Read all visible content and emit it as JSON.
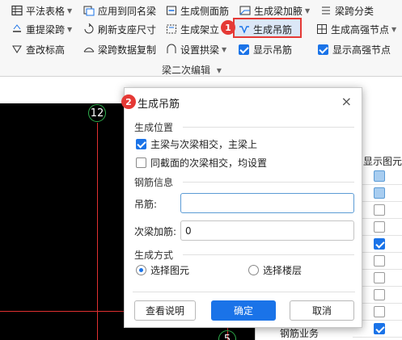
{
  "colors": {
    "accent": "#1a73e8",
    "annotation_red": "#e53935",
    "axis_red": "#e03030",
    "axis_green": "#2fae4c"
  },
  "ribbon": {
    "row1": [
      {
        "label": "平法表格",
        "icon": "table-icon",
        "dropdown": true
      },
      {
        "label": "应用到同名梁",
        "icon": "apply-same-name-icon",
        "dropdown": false
      },
      {
        "label": "生成侧面筋",
        "icon": "side-rebar-icon",
        "dropdown": false
      },
      {
        "label": "生成梁加腋",
        "icon": "beam-haunch-icon",
        "dropdown": true
      },
      {
        "label": "梁跨分类",
        "icon": "span-classify-icon",
        "dropdown": false
      }
    ],
    "row2": [
      {
        "label": "重提梁跨",
        "icon": "re-extract-span-icon",
        "dropdown": true
      },
      {
        "label": "刷新支座尺寸",
        "icon": "refresh-support-icon",
        "dropdown": false
      },
      {
        "label": "生成架立",
        "icon": "erection-bar-icon",
        "dropdown": false
      },
      {
        "label": "生成吊筋",
        "icon": "hanger-bar-icon",
        "dropdown": false
      },
      {
        "label": "生成高强节点",
        "icon": "high-strength-node-icon",
        "dropdown": true
      }
    ],
    "row3": [
      {
        "label": "查改标高",
        "icon": "elevation-icon",
        "dropdown": false
      },
      {
        "label": "梁跨数据复制",
        "icon": "span-copy-icon",
        "dropdown": false
      },
      {
        "label": "设置拱梁",
        "icon": "arch-beam-icon",
        "dropdown": true
      },
      {
        "label": "显示吊筋",
        "checked": true
      },
      {
        "label": "显示高强节点",
        "checked": true
      }
    ],
    "group_label": "梁二次编辑",
    "group_dropdown": "▾"
  },
  "badges": {
    "step1": "1",
    "step2": "2"
  },
  "canvas": {
    "axis_top": "12",
    "axis_bottom": "5"
  },
  "panel": {
    "header": "显示图元",
    "checkboxes": [
      "blue",
      "blue",
      "off",
      "off",
      "on",
      "off",
      "off",
      "off",
      "off",
      "on"
    ],
    "footer_text": "钢筋业务"
  },
  "dialog": {
    "title": "生成吊筋",
    "close": "×",
    "section_position": "生成位置",
    "option1": {
      "label": "主梁与次梁相交，主梁上",
      "checked": true
    },
    "option2": {
      "label": "同截面的次梁相交，均设置",
      "checked": false
    },
    "section_rebar": "钢筋信息",
    "hanger_label": "吊筋:",
    "hanger_value": "",
    "secondary_label": "次梁加筋:",
    "secondary_value": "0",
    "section_method": "生成方式",
    "radio_select_element": {
      "label": "选择图元",
      "checked": true
    },
    "radio_select_floor": {
      "label": "选择楼层",
      "checked": false
    },
    "btn_help": "查看说明",
    "btn_ok": "确定",
    "btn_cancel": "取消"
  }
}
